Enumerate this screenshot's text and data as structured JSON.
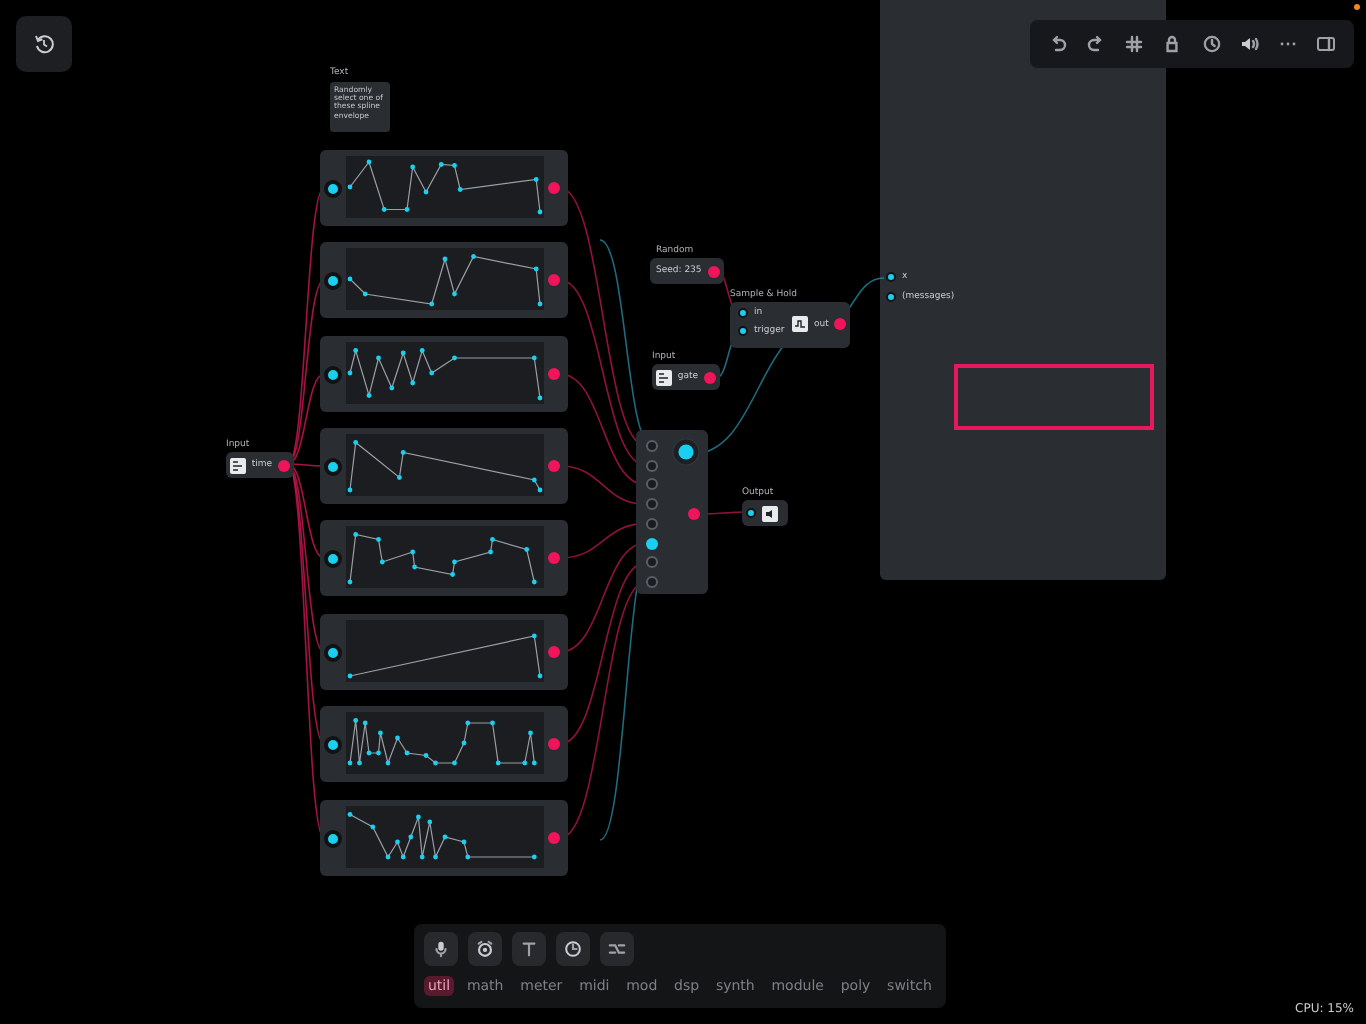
{
  "canvas": {
    "comment": {
      "label": "Text",
      "text": "Randomly select one of these spline envelope"
    },
    "input_time": {
      "label": "Input",
      "port": "time"
    },
    "mixer": {
      "inputs": [
        {
          "active": false
        },
        {
          "active": false
        },
        {
          "active": false
        },
        {
          "active": false
        },
        {
          "active": false
        },
        {
          "active": true
        },
        {
          "active": false
        },
        {
          "active": false
        }
      ]
    },
    "output": {
      "label": "Output"
    },
    "random": {
      "label": "Random",
      "value": "Seed: 235"
    },
    "sample_hold": {
      "label": "Sample & Hold",
      "inputs": [
        "in",
        "trigger"
      ],
      "output": "out"
    },
    "input_gate": {
      "label": "Input",
      "port": "gate"
    },
    "panel": {
      "ports": [
        "x",
        "(messages)"
      ]
    }
  },
  "palette": {
    "tabs": [
      {
        "label": "util",
        "selected": true
      },
      {
        "label": "math",
        "selected": false
      },
      {
        "label": "meter",
        "selected": false
      },
      {
        "label": "midi",
        "selected": false
      },
      {
        "label": "mod",
        "selected": false
      },
      {
        "label": "dsp",
        "selected": false
      },
      {
        "label": "synth",
        "selected": false
      },
      {
        "label": "module",
        "selected": false
      },
      {
        "label": "poly",
        "selected": false
      },
      {
        "label": "switch",
        "selected": false
      }
    ]
  },
  "status_bar": {
    "cpu": "CPU: 15%"
  }
}
